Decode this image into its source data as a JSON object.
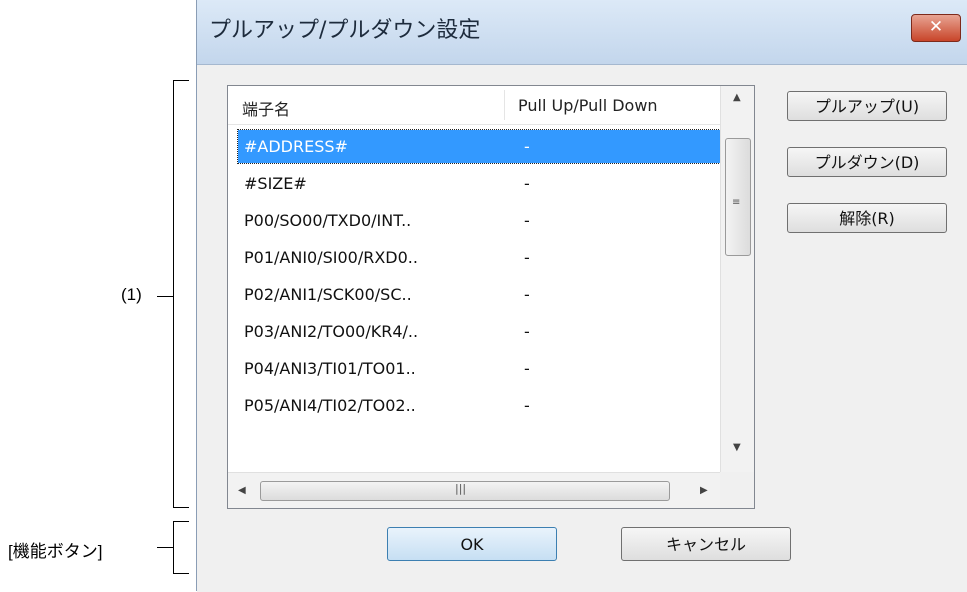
{
  "annotations": {
    "list_label": "(1)",
    "buttons_label": "[機能ボタン]"
  },
  "dialog": {
    "title": "プルアップ/プルダウン設定",
    "close_icon": "close-x-icon"
  },
  "table": {
    "columns": [
      "端子名",
      "Pull Up/Pull Down"
    ],
    "rows": [
      {
        "name": "#ADDRESS#",
        "value": "-",
        "selected": true
      },
      {
        "name": "#SIZE#",
        "value": "-"
      },
      {
        "name": "P00/SO00/TXD0/INT..",
        "value": "-"
      },
      {
        "name": "P01/ANI0/SI00/RXD0..",
        "value": "-"
      },
      {
        "name": "P02/ANI1/SCK00/SC..",
        "value": "-"
      },
      {
        "name": "P03/ANI2/TO00/KR4/..",
        "value": "-"
      },
      {
        "name": "P04/ANI3/TI01/TO01..",
        "value": "-"
      },
      {
        "name": "P05/ANI4/TI02/TO02..",
        "value": "-"
      }
    ]
  },
  "side_buttons": {
    "pullup": "プルアップ(U)",
    "pulldown": "プルダウン(D)",
    "release": "解除(R)"
  },
  "footer_buttons": {
    "ok": "OK",
    "cancel": "キャンセル"
  },
  "colors": {
    "selection": "#3399ff",
    "titlebar": "#c3d6ec",
    "close_button": "#c8452a"
  }
}
